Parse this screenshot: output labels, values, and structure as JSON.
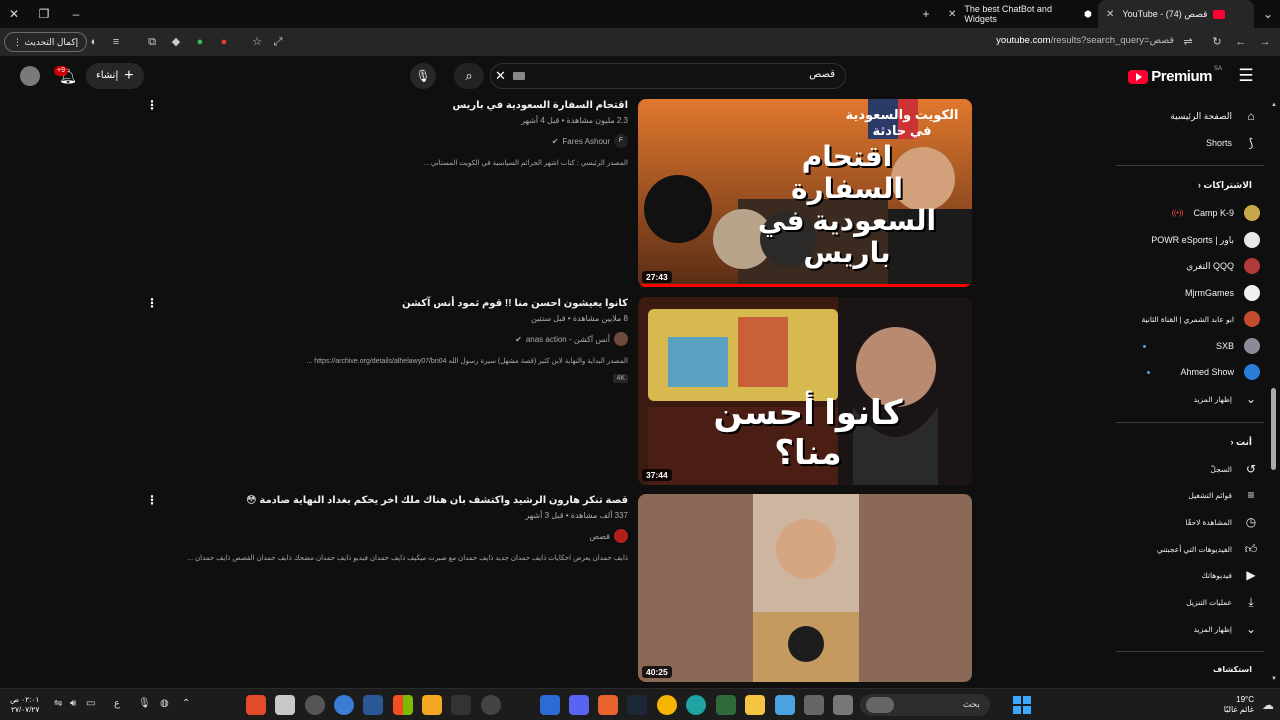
{
  "browser": {
    "tabs": [
      {
        "title": "YouTube - قصص (74)",
        "active": true
      },
      {
        "title": "The best ChatBot and Widgets",
        "active": false
      }
    ],
    "update_button": "إكمال التحديث",
    "address": {
      "host": "youtube.com",
      "path": "/results?search_query=قصص"
    }
  },
  "masthead": {
    "logo_text": "Premium",
    "logo_region": "SA",
    "search_query": "قصص",
    "create_label": "إنشاء",
    "notifications_count": "+9"
  },
  "results": [
    {
      "title": "اقتحام السفارة السعودية في باريس",
      "views_age": "2.3 مليون مشاهدة • قبل 4 أشهر",
      "channel": "Fares Ashour",
      "description": "المصدر الرئيسي : كتاب اشهر الجرائم السياسية في الكويت المستاني ...",
      "duration": "27:43",
      "thumb_title": "اقتحام السفارة السعودية في باريس",
      "thumb_subtitle": "الكويت والسعودية في حادثة",
      "watched_fraction": 1.0,
      "chip": ""
    },
    {
      "title": "كانوا يعيشون احسن منا !! قوم ثمود أنس آكشن",
      "views_age": "8 ملايين مشاهدة • قبل سنتين",
      "channel": "أنس آكشن - anas action",
      "description": "المصدر البداية والنهاية لابن كثير (قصة مشهل) سيرة رسول الله https://archive.org/details/alhelawy07/bn04 ...",
      "duration": "37:44",
      "thumb_title": "كانوا أحسن منا؟",
      "watched_fraction": 0,
      "chip": "4K"
    },
    {
      "title": "قصة تنكر هارون الرشيد واكتشف بان هناك ملك اخر يحكم بغداد النهاية صادمة 😳",
      "views_age": "337 ألف مشاهدة • قبل 3 أشهر",
      "channel": "قصص",
      "description": "ذايف حمدان يعرض احكايات ذايف حمدان جديد ذايف حمدان مع صبرت ميكيف ذايف حمدان فيديو ذايف حمدان مضحك ذايف حمدان القصص ذايف حمدان ...",
      "duration": "40:25",
      "watched_fraction": 0,
      "chip": ""
    }
  ],
  "sidebar": {
    "top": [
      {
        "label": "الصفحة الرئيسية",
        "icon": "home-icon"
      },
      {
        "label": "Shorts",
        "icon": "shorts-icon"
      }
    ],
    "subscriptions_heading": "الاشتراكات",
    "subscriptions": [
      {
        "label": "Camp K-9",
        "color": "#c9a84a",
        "live": true,
        "new": false
      },
      {
        "label": "POWR eSports | باور",
        "color": "#e8e8e8",
        "live": false,
        "new": false
      },
      {
        "label": "التغري QQQ",
        "color": "#b23a3a",
        "live": false,
        "new": false
      },
      {
        "label": "MjrmGames",
        "color": "#f1f1f1",
        "live": false,
        "new": false
      },
      {
        "label": "ابو عابد الشمري | القناة الثانية",
        "color": "#c44a2e",
        "live": false,
        "new": false
      },
      {
        "label": "SXB",
        "color": "#8a8a9a",
        "live": false,
        "new": true
      },
      {
        "label": "Ahmed Show",
        "color": "#2a7bd6",
        "live": false,
        "new": true
      }
    ],
    "show_more_1": "إظهار المزيد",
    "you_heading": "أنت",
    "you_items": [
      {
        "label": "السجلّ",
        "icon": "history-icon"
      },
      {
        "label": "قوائم التشغيل",
        "icon": "playlists-icon"
      },
      {
        "label": "المشاهدة لاحقًا",
        "icon": "watch-later-icon"
      },
      {
        "label": "الفيديوهات التي أعجبتني",
        "icon": "liked-icon"
      },
      {
        "label": "فيديوهاتك",
        "icon": "your-videos-icon"
      },
      {
        "label": "عمليات التنزيل",
        "icon": "download-icon"
      }
    ],
    "show_more_2": "إظهار المزيد",
    "explore_heading": "استكشاف"
  },
  "taskbar": {
    "time": "٠٢:٠١ ص",
    "date": "٢٧/٠٧/٢٧",
    "search_label": "بحث",
    "weather_temp": "19°C",
    "weather_desc": "غائم غالبًا",
    "lang": "ع"
  }
}
